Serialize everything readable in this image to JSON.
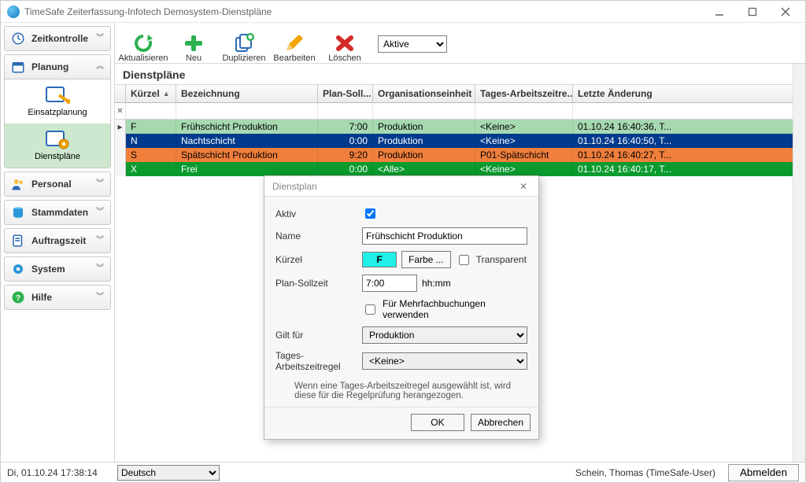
{
  "window": {
    "title": "TimeSafe Zeiterfassung-Infotech Demosystem-Dienstpläne"
  },
  "sidebar": {
    "groups": [
      {
        "id": "zeitkontrolle",
        "label": "Zeitkontrolle"
      },
      {
        "id": "planung",
        "label": "Planung"
      },
      {
        "id": "personal",
        "label": "Personal"
      },
      {
        "id": "stammdaten",
        "label": "Stammdaten"
      },
      {
        "id": "auftragszeit",
        "label": "Auftragszeit"
      },
      {
        "id": "system",
        "label": "System"
      },
      {
        "id": "hilfe",
        "label": "Hilfe"
      }
    ],
    "planung_children": [
      {
        "id": "einsatzplanung",
        "label": "Einsatzplanung"
      },
      {
        "id": "dienstplaene",
        "label": "Dienstpläne"
      }
    ]
  },
  "toolbar": {
    "refresh": "Aktualisieren",
    "new": "Neu",
    "duplicate": "Duplizieren",
    "edit": "Bearbeiten",
    "delete": "Löschen",
    "filter_value": "Aktive"
  },
  "grid": {
    "title": "Dienstpläne",
    "columns": {
      "kuerzel": "Kürzel",
      "bezeichnung": "Bezeichnung",
      "plansoll": "Plan-Soll...",
      "orgeinheit": "Organisationseinheit",
      "tagesregel": "Tages-Arbeitszeitre...",
      "aenderung": "Letzte Änderung"
    },
    "rows": [
      {
        "style": "row-f",
        "indicator": "▸",
        "kuerzel": "F",
        "bezeichnung": "Frühschicht Produktion",
        "plansoll": "7:00",
        "org": "Produktion",
        "regel": "<Keine>",
        "aenderung": "01.10.24 16:40:36, T..."
      },
      {
        "style": "row-n",
        "indicator": "",
        "kuerzel": "N",
        "bezeichnung": "Nachtschicht",
        "plansoll": "0:00",
        "org": "Produktion",
        "regel": "<Keine>",
        "aenderung": "01.10.24 16:40:50, T..."
      },
      {
        "style": "row-s",
        "indicator": "",
        "kuerzel": "S",
        "bezeichnung": "Spätschicht Produktion",
        "plansoll": "9:20",
        "org": "Produktion",
        "regel": "P01-Spätschicht",
        "aenderung": "01.10.24 16:40:27, T..."
      },
      {
        "style": "row-x",
        "indicator": "",
        "kuerzel": "X",
        "bezeichnung": "Frei",
        "plansoll": "0:00",
        "org": "<Alle>",
        "regel": "<Keine>",
        "aenderung": "01.10.24 16:40:17, T..."
      }
    ]
  },
  "modal": {
    "title": "Dienstplan",
    "labels": {
      "aktiv": "Aktiv",
      "name": "Name",
      "kuerzel": "Kürzel",
      "farbe": "Farbe ...",
      "transparent": "Transparent",
      "plansoll": "Plan-Sollzeit",
      "hhmm": "hh:mm",
      "mehrfach": "Für Mehrfachbuchungen verwenden",
      "giltfuer": "Gilt für",
      "tagesregel": "Tages-Arbeitszeitregel",
      "note": "Wenn eine Tages-Arbeitszeitregel ausgewählt ist, wird diese für die Regelprüfung herangezogen.",
      "ok": "OK",
      "cancel": "Abbrechen"
    },
    "values": {
      "aktiv": true,
      "name": "Frühschicht Produktion",
      "kuerzel": "F",
      "kuerzel_color": "#20f0e6",
      "transparent": false,
      "plansoll": "7:00",
      "mehrfach": false,
      "giltfuer": "Produktion",
      "tagesregel": "<Keine>"
    }
  },
  "status": {
    "datetime": "Di, 01.10.24 17:38:14",
    "language": "Deutsch",
    "user": "Schein, Thomas (TimeSafe-User)",
    "logout": "Abmelden"
  }
}
